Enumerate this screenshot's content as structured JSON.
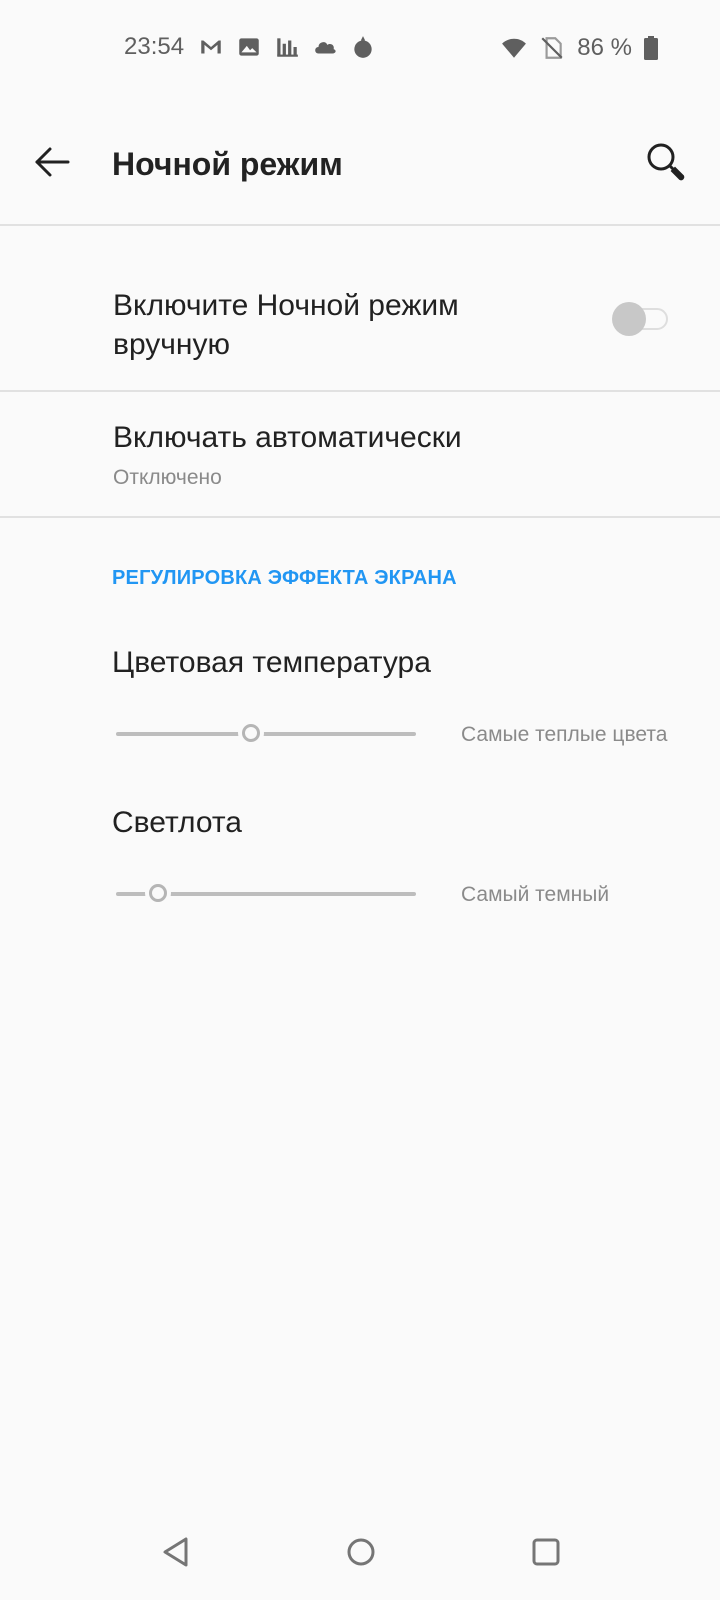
{
  "status_bar": {
    "time": "23:54",
    "left_icons": [
      "gmail-icon",
      "gallery-icon",
      "stats-icon",
      "cloud-icon",
      "fire-app-icon"
    ],
    "right_icons": [
      "wifi-icon",
      "no-sim-icon"
    ],
    "battery_percent": "86 %"
  },
  "app_bar": {
    "title": "Ночной режим",
    "back_icon": "arrow-left-icon",
    "search_icon": "search-icon"
  },
  "settings": {
    "manual": {
      "title": "Включите Ночной режим вручную",
      "enabled": false
    },
    "auto": {
      "title": "Включать автоматически",
      "subtitle": "Отключено"
    }
  },
  "section": {
    "header": "РЕГУЛИРОВКА ЭФФЕКТА ЭКРАНА"
  },
  "color_temperature": {
    "label": "Цветовая температура",
    "value_text": "Самые теплые цвета",
    "level": 0.45
  },
  "brightness": {
    "label": "Светлота",
    "value_text": "Самый темный",
    "level": 0.14
  },
  "colors": {
    "accent": "#2196f3",
    "background": "#fafafa",
    "divider": "#e1e1e1"
  },
  "nav_bar": {
    "icons": [
      "nav-back-icon",
      "nav-home-icon",
      "nav-recents-icon"
    ]
  }
}
